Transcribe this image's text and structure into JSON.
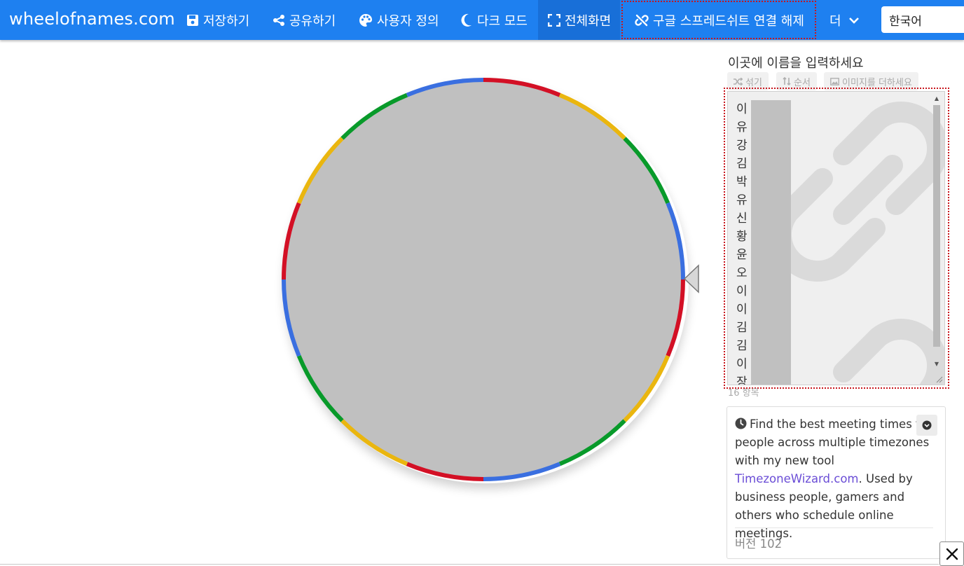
{
  "header": {
    "brand": "wheelofnames.com",
    "nav": [
      {
        "label": "저장하기",
        "icon": "save-icon"
      },
      {
        "label": "공유하기",
        "icon": "share-icon"
      },
      {
        "label": "사용자 정의",
        "icon": "palette-icon"
      },
      {
        "label": "다크 모드",
        "icon": "moon-icon"
      },
      {
        "label": "전체화면",
        "icon": "fullscreen-icon"
      },
      {
        "label": "구글 스프레드쉬트 연결 해제",
        "icon": "unlink-icon"
      },
      {
        "label": "더",
        "icon": "chevron-down-icon"
      }
    ],
    "language": "한국어"
  },
  "wheel": {
    "segment_colors": [
      "#d31025",
      "#eab60f",
      "#089a2a",
      "#3a6fe0"
    ],
    "center_color": "#c0c0c0"
  },
  "panel": {
    "title": "이곳에 이름을 입력하세요",
    "tools": {
      "shuffle": "섞기",
      "sort": "순서",
      "image": "이미지를 더하세요"
    },
    "entries_visible": [
      "이",
      "유",
      "강",
      "김",
      "박",
      "유",
      "신",
      "황",
      "윤",
      "오",
      "이",
      "이",
      "김",
      "김",
      "이",
      "장"
    ],
    "count_label": "16 항목"
  },
  "card": {
    "text_before": "Find the best meeting times for people across multiple timezones with my new tool ",
    "link": "TimezoneWizard.com",
    "text_after": ". Used by business people, gamers and others who schedule online meetings.",
    "version": "버전 102"
  }
}
